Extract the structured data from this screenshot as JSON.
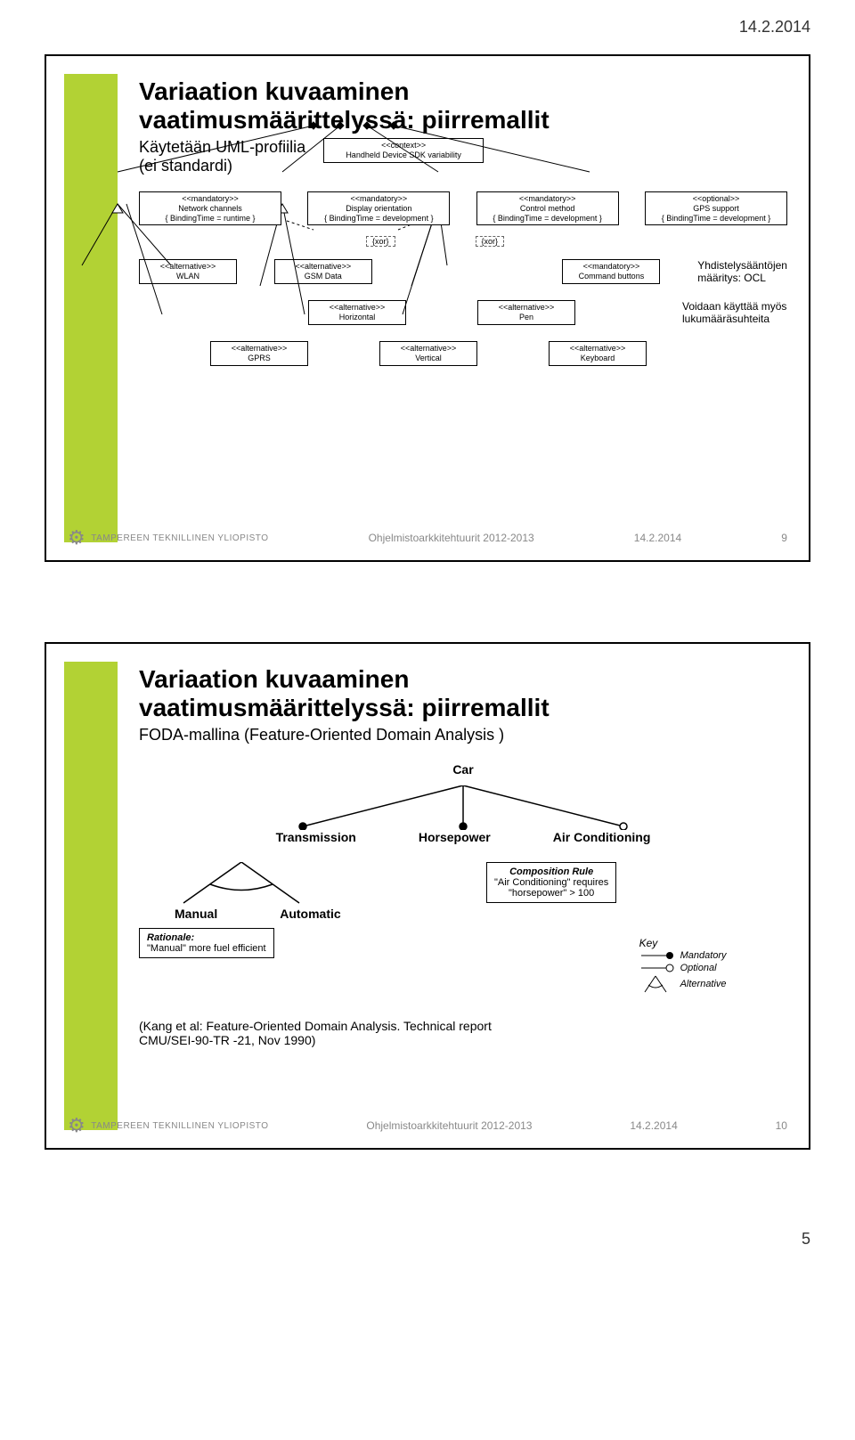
{
  "page_header_date": "14.2.2014",
  "page_number": "5",
  "slide1": {
    "title_line1": "Variaation kuvaaminen",
    "title_line2": "vaatimusmäärittelyssä: piirremallit",
    "subtitle_line1": "Käytetään UML-profiilia",
    "subtitle_line2": "(ei standardi)",
    "context_box_l1": "<<context>>",
    "context_box_l2": "Handheld Device SDK variability",
    "row1": [
      {
        "l1": "<<mandatory>>",
        "l2": "Network channels",
        "l3": "{ BindingTime = runtime }"
      },
      {
        "l1": "<<mandatory>>",
        "l2": "Display orientation",
        "l3": "{ BindingTime = development }"
      },
      {
        "l1": "<<mandatory>>",
        "l2": "Control method",
        "l3": "{ BindingTime = development }"
      },
      {
        "l1": "<<optional>>",
        "l2": "GPS support",
        "l3": "{ BindingTime = development }"
      }
    ],
    "xor_label": "{xor}",
    "row2": [
      {
        "l1": "<<alternative>>",
        "l2": "WLAN"
      },
      {
        "l1": "<<alternative>>",
        "l2": "GSM Data"
      },
      {
        "l1": "<<mandatory>>",
        "l2": "Command buttons"
      }
    ],
    "note1_l1": "Yhdistelysääntöjen",
    "note1_l2": "määritys: OCL",
    "row3": [
      {
        "l1": "<<alternative>>",
        "l2": "Horizontal"
      },
      {
        "l1": "<<alternative>>",
        "l2": "Pen"
      }
    ],
    "note2_l1": "Voidaan käyttää myös",
    "note2_l2": "lukumääräsuhteita",
    "row4": [
      {
        "l1": "<<alternative>>",
        "l2": "GPRS"
      },
      {
        "l1": "<<alternative>>",
        "l2": "Vertical"
      },
      {
        "l1": "<<alternative>>",
        "l2": "Keyboard"
      }
    ],
    "footer_logo": "TAMPEREEN TEKNILLINEN YLIOPISTO",
    "footer_course": "Ohjelmistoarkkitehtuurit 2012-2013",
    "footer_date": "14.2.2014",
    "footer_page": "9"
  },
  "slide2": {
    "title_line1": "Variaation kuvaaminen",
    "title_line2": "vaatimusmäärittelyssä: piirremallit",
    "subtitle": "FODA-mallina (Feature-Oriented Domain Analysis )",
    "car": "Car",
    "features": [
      "Transmission",
      "Horsepower",
      "Air Conditioning"
    ],
    "comp_rule_title": "Composition Rule",
    "comp_rule_l1": "\"Air Conditioning\" requires",
    "comp_rule_l2": "\"horsepower\" > 100",
    "sub_features": [
      "Manual",
      "Automatic"
    ],
    "rationale_title": "Rationale:",
    "rationale_text": "\"Manual\" more fuel efficient",
    "key_title": "Key",
    "key_items": [
      "Mandatory",
      "Optional",
      "Alternative"
    ],
    "ref_l1": "(Kang et al: Feature-Oriented Domain Analysis. Technical report",
    "ref_l2": "CMU/SEI-90-TR -21, Nov 1990)",
    "footer_logo": "TAMPEREEN TEKNILLINEN YLIOPISTO",
    "footer_course": "Ohjelmistoarkkitehtuurit 2012-2013",
    "footer_date": "14.2.2014",
    "footer_page": "10"
  }
}
